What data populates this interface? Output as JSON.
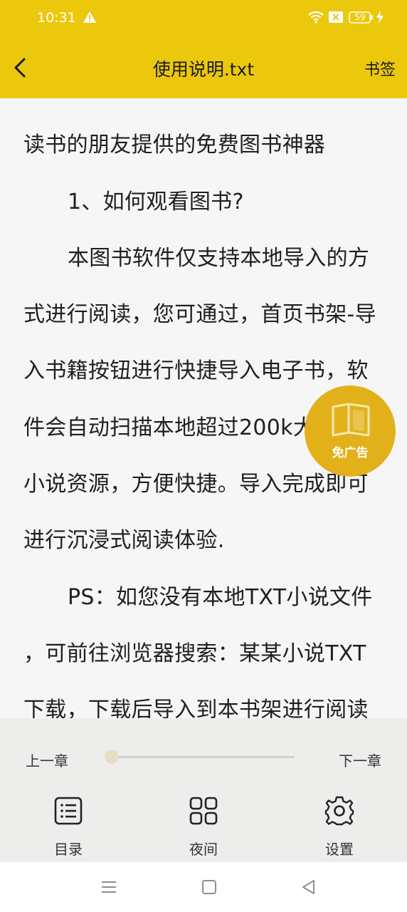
{
  "status_bar": {
    "time": "10:31",
    "battery": "59",
    "icons": [
      "warning-icon",
      "wifi-icon",
      "sim-x-icon",
      "battery-icon",
      "charging-icon"
    ]
  },
  "header": {
    "title": "使用说明.txt",
    "bookmark_label": "书签",
    "back_icon": "chevron-left-icon",
    "background": "#ecc80d"
  },
  "content": {
    "lines": [
      "读书的朋友提供的免费图书神器",
      "1、如何观看图书?",
      "本图书软件仅支持本地导入的方",
      "式进行阅读，您可通过，首页书架-导",
      "入书籍按钮进行快捷导入电子书，软",
      "件会自动扫描本地超过200k大",
      "小说资源，方便快捷。导入完成即可",
      "进行沉浸式阅读体验.",
      "PS：如您没有本地TXT小说文件",
      "，可前往浏览器搜索：某某小说TXT",
      "下载，下载后导入到本书架进行阅读"
    ]
  },
  "promo": {
    "label": "免广告",
    "icon": "book-icon",
    "color": "#e2b11a"
  },
  "chapter_nav": {
    "prev_label": "上一章",
    "next_label": "下一章",
    "progress": 0
  },
  "toolbar": {
    "items": [
      {
        "label": "目录",
        "icon": "list-icon"
      },
      {
        "label": "夜间",
        "icon": "grid-icon"
      },
      {
        "label": "设置",
        "icon": "gear-icon"
      }
    ]
  },
  "system_nav": {
    "icons": [
      "menu-icon",
      "home-icon",
      "back-triangle-icon"
    ]
  }
}
